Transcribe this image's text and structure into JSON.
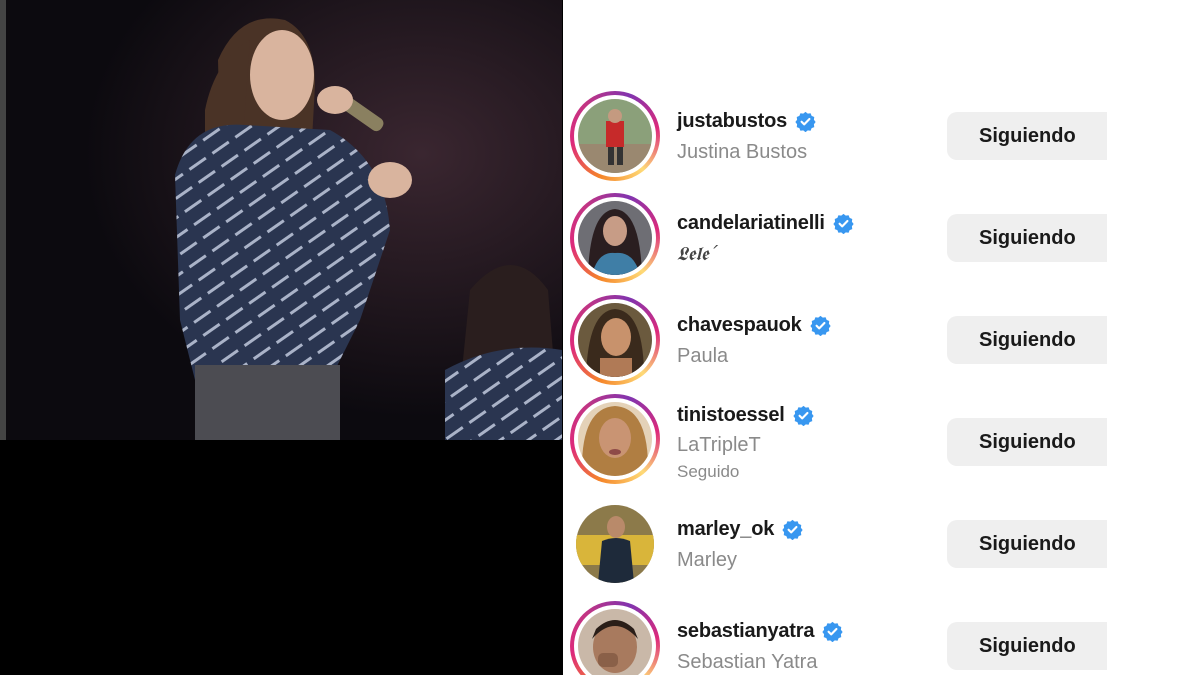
{
  "accounts": [
    {
      "username": "justabustos",
      "name": "Justina Bustos",
      "subtext": "",
      "button": "Siguiendo",
      "ring": true
    },
    {
      "username": "candelariatinelli",
      "name": "𝕷𝖊𝖑𝖊´",
      "subtext": "",
      "button": "Siguiendo",
      "ring": true
    },
    {
      "username": "chavespauok",
      "name": "Paula",
      "subtext": "",
      "button": "Siguiendo",
      "ring": true
    },
    {
      "username": "tinistoessel",
      "name": "LaTripleT",
      "subtext": "Seguido",
      "button": "Siguiendo",
      "ring": true
    },
    {
      "username": "marley_ok",
      "name": "Marley",
      "subtext": "",
      "button": "Siguiendo",
      "ring": false
    },
    {
      "username": "sebastianyatra",
      "name": "Sebastian Yatra",
      "subtext": "",
      "button": "Siguiendo",
      "ring": true
    }
  ],
  "colors": {
    "verified": "#3897f0",
    "button_bg": "#efefef",
    "secondary_text": "#8a8a8a"
  }
}
